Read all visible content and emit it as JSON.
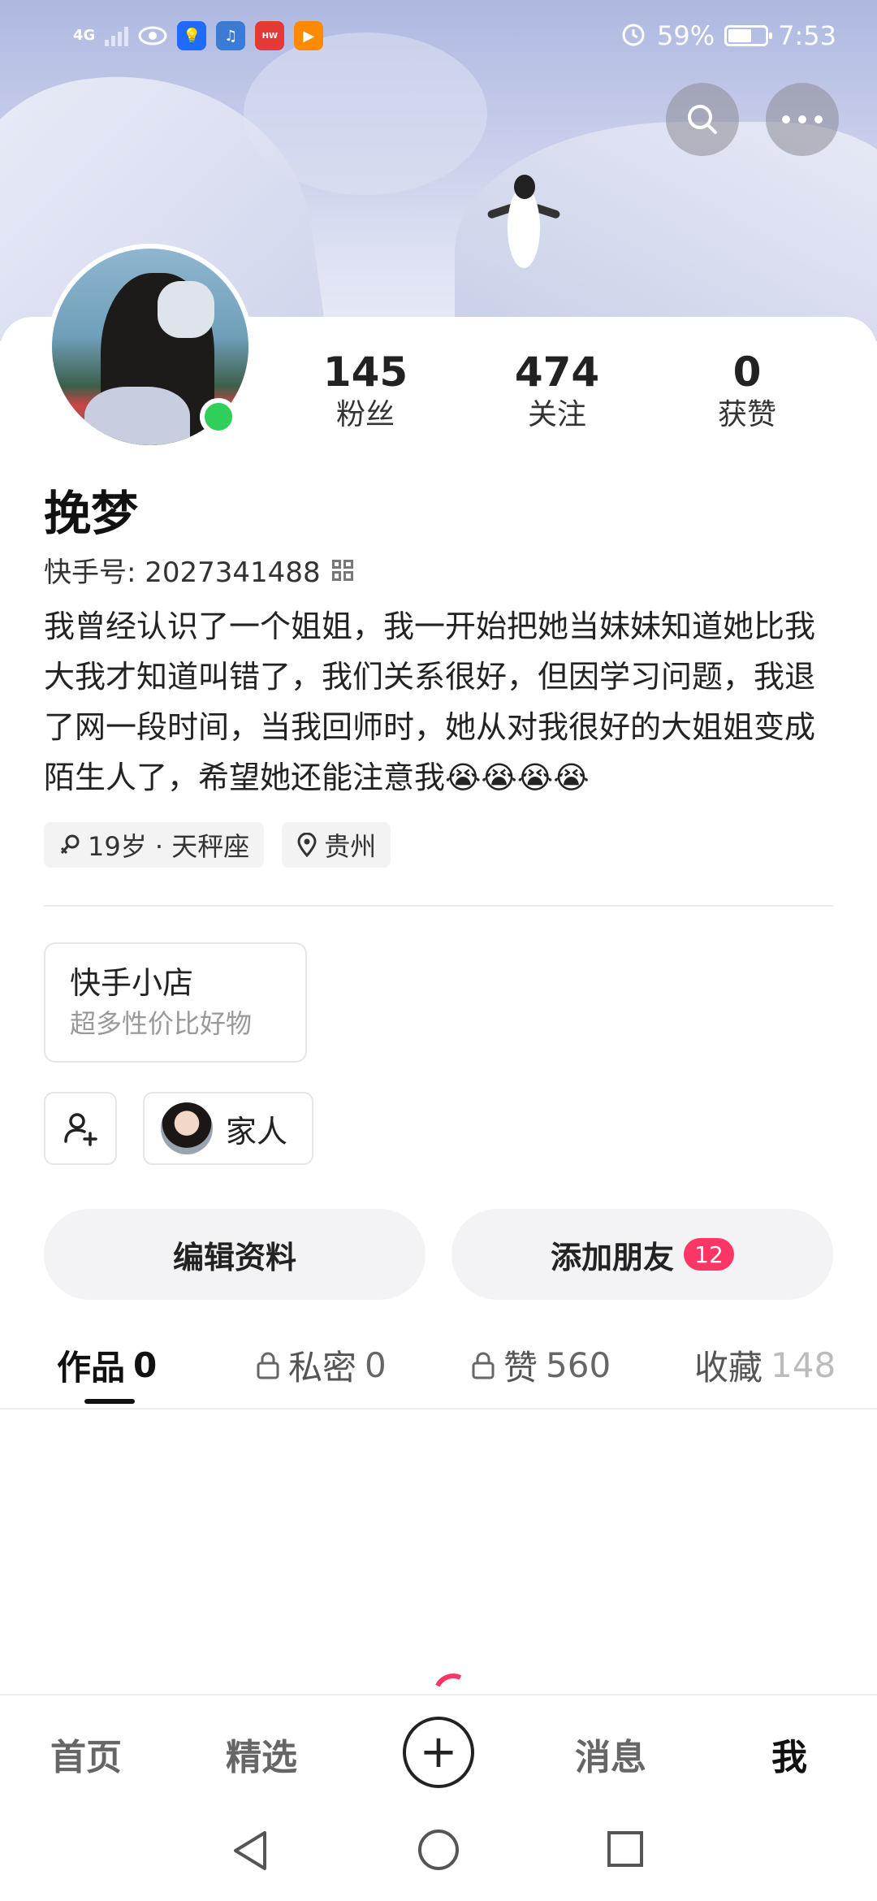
{
  "status_bar": {
    "network": "4G",
    "battery_percent": "59%",
    "battery_level": 0.59,
    "time": "7:53",
    "app_icons": [
      "eye-icon",
      "bulb-icon",
      "music-icon",
      "huawei-icon",
      "play-icon"
    ]
  },
  "header": {
    "search_icon": "search-icon",
    "more_icon": "more-icon"
  },
  "profile": {
    "stats": [
      {
        "num": "145",
        "label": "粉丝"
      },
      {
        "num": "474",
        "label": "关注"
      },
      {
        "num": "0",
        "label": "获赞"
      }
    ],
    "username": "挽梦",
    "kuaishou_id": "快手号: 2027341488",
    "bio": "我曾经认识了一个姐姐，我一开始把她当妹妹知道她比我大我才知道叫错了，我们关系很好，但因学习问题，我退了网一段时间，当我回师时，她从对我很好的大姐姐变成陌生人了，希望她还能注意我😭😭😭😭",
    "tags": [
      {
        "icon": "female-icon",
        "text": "19岁 · 天秤座"
      },
      {
        "icon": "location-icon",
        "text": "贵州"
      }
    ]
  },
  "shop": {
    "title": "快手小店",
    "subtitle": "超多性价比好物"
  },
  "family": {
    "label": "家人"
  },
  "actions": {
    "edit_label": "编辑资料",
    "add_friend_label": "添加朋友",
    "add_friend_badge": "12"
  },
  "tabs": [
    {
      "label": "作品",
      "count": "0",
      "locked": false
    },
    {
      "label": "私密",
      "count": "0",
      "locked": true
    },
    {
      "label": "赞",
      "count": "560",
      "locked": true
    },
    {
      "label": "收藏",
      "count": "148",
      "locked": false
    }
  ],
  "bottom_nav": {
    "home": "首页",
    "featured": "精选",
    "messages": "消息",
    "me": "我"
  },
  "colors": {
    "accent": "#fe3666",
    "online": "#2fcf5a"
  }
}
